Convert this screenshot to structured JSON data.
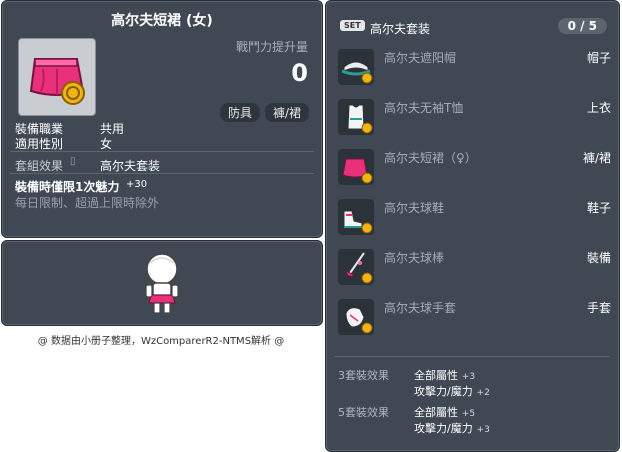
{
  "item_id": "01061204",
  "item": {
    "name": "高尔夫短裙 (女)",
    "power_label": "戰鬥力提升量",
    "power_value": "0",
    "tags": [
      "防具",
      "褲/裙"
    ],
    "job_label": "裝備職業",
    "job_value": "共用",
    "gender_label": "適用性別",
    "gender_value": "女",
    "set_label": "套組效果",
    "set_value": "高尔夫套装",
    "equip_bonus": "裝備時僅限1次魅力",
    "equip_bonus_value": "+30",
    "limit_text": "每日限制、超過上限時除外"
  },
  "footer": "@ 数据由小册子整理，WzComparerR2-NTMS解析 @",
  "set": {
    "badge": "SET",
    "name": "高尔夫套装",
    "count": "0 / 5",
    "items": [
      {
        "name": "高尔夫遮阳帽",
        "category": "帽子",
        "icon": "visor-icon"
      },
      {
        "name": "高尔夫无袖T恤",
        "category": "上衣",
        "icon": "sleeveless-shirt-icon"
      },
      {
        "name": "高尔夫短裙（♀）",
        "category": "褲/裙",
        "icon": "skirt-icon"
      },
      {
        "name": "高尔夫球鞋",
        "category": "鞋子",
        "icon": "shoes-icon"
      },
      {
        "name": "高尔夫球棒",
        "category": "裝備",
        "icon": "golf-club-icon"
      },
      {
        "name": "高尔夫球手套",
        "category": "手套",
        "icon": "glove-icon"
      }
    ],
    "effects": [
      {
        "label": "3套裝效果",
        "lines": [
          {
            "stat": "全部屬性",
            "value": "+3"
          },
          {
            "stat": "攻擊力/魔力",
            "value": "+2"
          }
        ]
      },
      {
        "label": "5套裝效果",
        "lines": [
          {
            "stat": "全部屬性",
            "value": "+5"
          },
          {
            "stat": "攻擊力/魔力",
            "value": "+3"
          }
        ]
      }
    ]
  },
  "colors": {
    "panel_bg": "#404854",
    "accent_pink": "#e8317a",
    "coin_gold": "#f0b419"
  }
}
